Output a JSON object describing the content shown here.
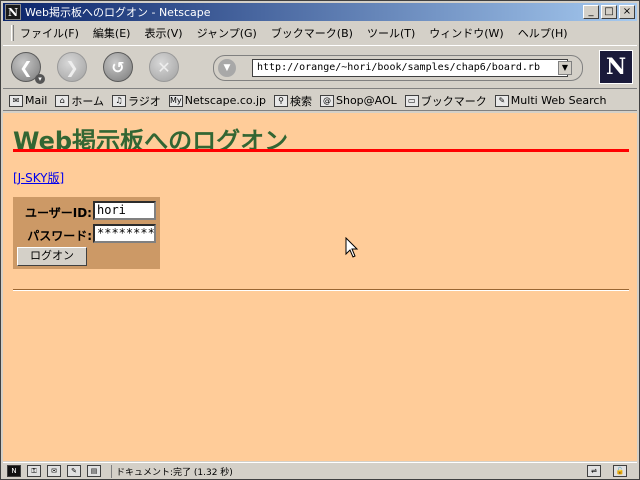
{
  "window": {
    "title": "Web掲示板へのログオン - Netscape",
    "app_icon": "N"
  },
  "menu": {
    "items": [
      "ファイル(F)",
      "編集(E)",
      "表示(V)",
      "ジャンプ(G)",
      "ブックマーク(B)",
      "ツール(T)",
      "ウィンドウ(W)",
      "ヘルプ(H)"
    ]
  },
  "nav": {
    "url": "http://orange/~hori/book/samples/chap6/board.rb",
    "throbber": "N"
  },
  "personal_toolbar": {
    "items": [
      "Mail",
      "ホーム",
      "ラジオ",
      "Netscape.co.jp",
      "検索",
      "Shop@AOL",
      "ブックマーク",
      "Multi Web Search"
    ]
  },
  "page": {
    "heading": "Web掲示板へのログオン",
    "jsky_link": "[J-SKY版]",
    "form": {
      "user_label": "ユーザーID:",
      "user_value": "hori",
      "password_label": "パスワード:",
      "password_value": "********",
      "submit_label": "ログオン"
    },
    "colors": {
      "background": "#ffcc99",
      "heading": "#336633",
      "rule": "#ff0000",
      "form_bg": "#cc9966"
    }
  },
  "status": {
    "text": "ドキュメント:完了 (1.32 秒)"
  }
}
